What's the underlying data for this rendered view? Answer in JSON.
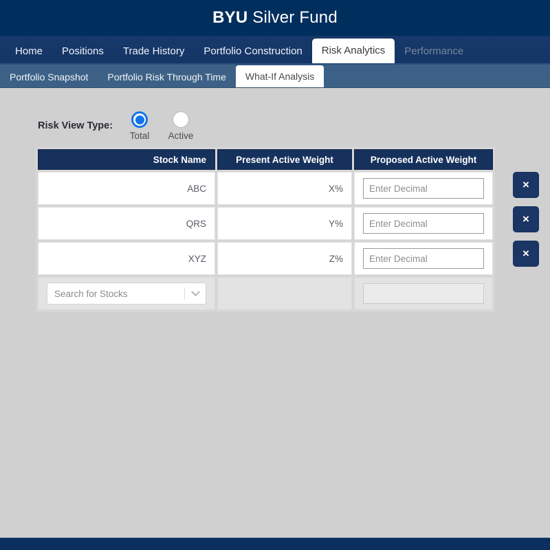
{
  "header": {
    "brand": "BYU",
    "title_rest": "Silver Fund"
  },
  "main_nav": {
    "tabs": [
      {
        "label": "Home",
        "state": "normal"
      },
      {
        "label": "Positions",
        "state": "normal"
      },
      {
        "label": "Trade History",
        "state": "normal"
      },
      {
        "label": "Portfolio Construction",
        "state": "normal"
      },
      {
        "label": "Risk Analytics",
        "state": "active"
      },
      {
        "label": "Performance",
        "state": "disabled"
      }
    ]
  },
  "sub_nav": {
    "tabs": [
      {
        "label": "Portfolio Snapshot",
        "state": "normal"
      },
      {
        "label": "Portfolio Risk Through Time",
        "state": "normal"
      },
      {
        "label": "What-If Analysis",
        "state": "active"
      }
    ]
  },
  "risk_view": {
    "label": "Risk View Type:",
    "options": [
      {
        "label": "Total",
        "selected": true
      },
      {
        "label": "Active",
        "selected": false
      }
    ]
  },
  "table": {
    "headers": {
      "stock_name": "Stock Name",
      "present_active_weight": "Present Active Weight",
      "proposed_active_weight": "Proposed Active Weight"
    },
    "rows": [
      {
        "stock": "ABC",
        "present": "X%",
        "proposed_placeholder": "Enter Decimal",
        "proposed_value": ""
      },
      {
        "stock": "QRS",
        "present": "Y%",
        "proposed_placeholder": "Enter Decimal",
        "proposed_value": ""
      },
      {
        "stock": "XYZ",
        "present": "Z%",
        "proposed_placeholder": "Enter Decimal",
        "proposed_value": ""
      }
    ],
    "footer_row": {
      "search_placeholder": "Search for Stocks",
      "disabled_input_placeholder": ""
    },
    "delete_button_label": "×",
    "delete_buttons": [
      {
        "label": "×"
      },
      {
        "label": "×"
      },
      {
        "label": "×"
      }
    ]
  },
  "colors": {
    "header_navy": "#002e5d",
    "nav_navy": "#143566",
    "subnav_blue": "#3d6186",
    "table_header_navy": "#16315c",
    "page_bg": "#d0d0d0",
    "radio_blue": "#1273ea",
    "delete_btn": "#1b3665",
    "footer_navy": "#0b2f5e"
  }
}
